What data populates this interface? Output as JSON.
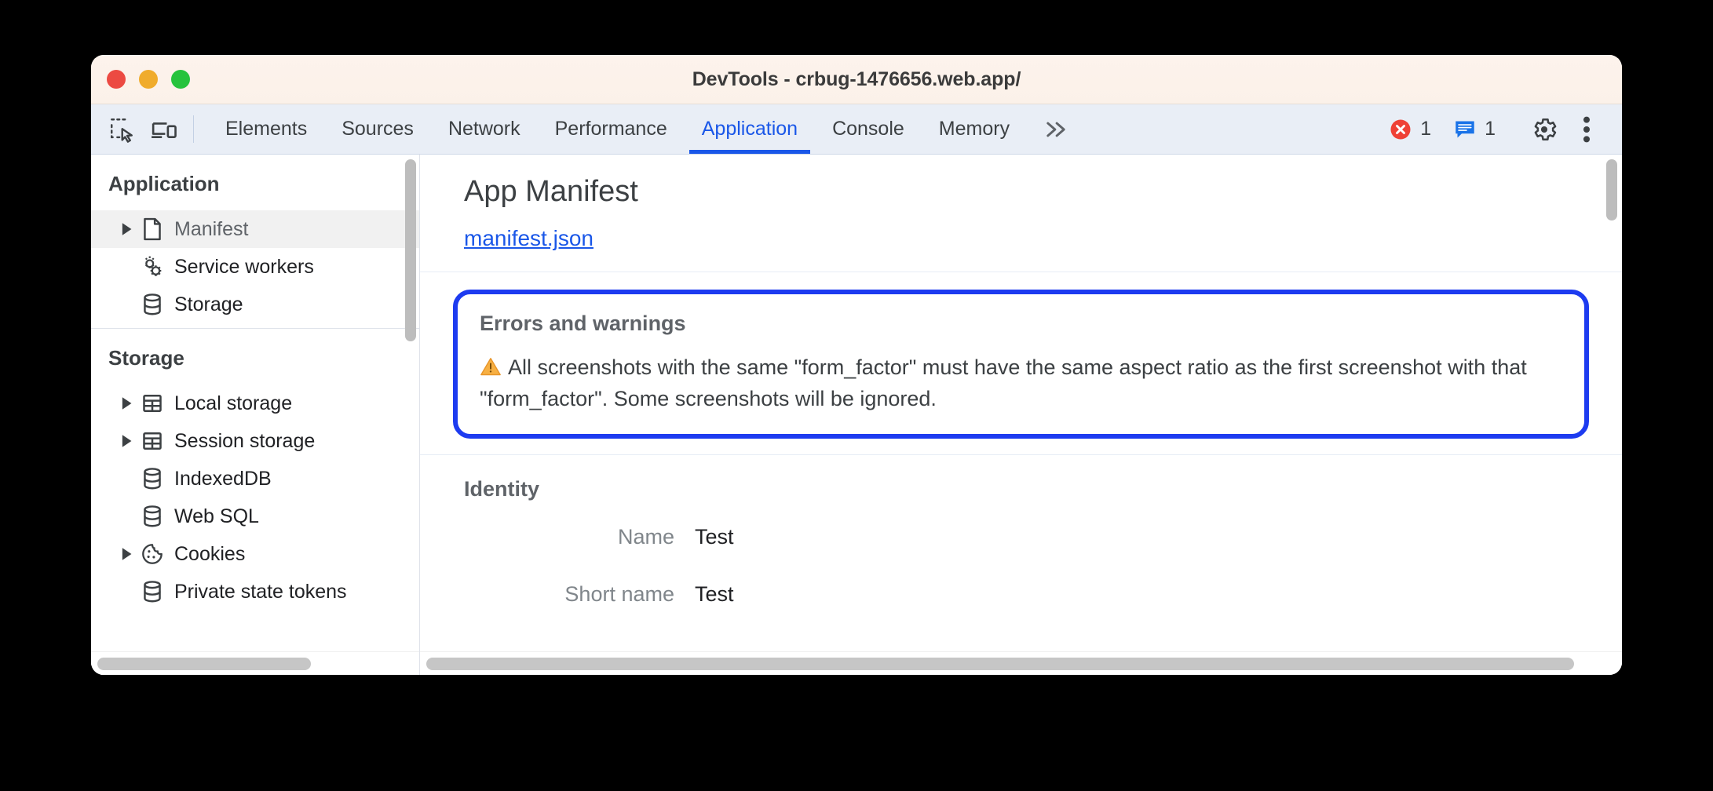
{
  "window": {
    "title": "DevTools - crbug-1476656.web.app/",
    "traffic_lights": [
      "close-red",
      "minimize-amber",
      "zoom-green"
    ],
    "colors": {
      "titlebar_bg": "#fbf1e9",
      "toolbar_bg": "#e9eef6",
      "accent_blue": "#1a57e8",
      "highlight_border": "#1d3bf0",
      "warning_orange": "#f5a623",
      "error_red": "#ef4136"
    }
  },
  "toolbar": {
    "inspect_icon": "inspect-element-icon",
    "device_icon": "device-toolbar-icon",
    "tabs": [
      {
        "label": "Elements",
        "active": false
      },
      {
        "label": "Sources",
        "active": false
      },
      {
        "label": "Network",
        "active": false
      },
      {
        "label": "Performance",
        "active": false
      },
      {
        "label": "Application",
        "active": true
      },
      {
        "label": "Console",
        "active": false
      },
      {
        "label": "Memory",
        "active": false
      }
    ],
    "more_tabs_glyph": "»",
    "error_count": "1",
    "message_count": "1",
    "settings_icon": "gear-icon",
    "more_icon": "three-dot-menu-icon"
  },
  "sidebar": {
    "sections": [
      {
        "title": "Application",
        "items": [
          {
            "label": "Manifest",
            "icon": "document-icon",
            "expandable": true,
            "selected": true
          },
          {
            "label": "Service workers",
            "icon": "gears-icon",
            "expandable": false,
            "selected": false
          },
          {
            "label": "Storage",
            "icon": "database-icon",
            "expandable": false,
            "selected": false
          }
        ]
      },
      {
        "title": "Storage",
        "items": [
          {
            "label": "Local storage",
            "icon": "table-icon",
            "expandable": true,
            "selected": false
          },
          {
            "label": "Session storage",
            "icon": "table-icon",
            "expandable": true,
            "selected": false
          },
          {
            "label": "IndexedDB",
            "icon": "database-icon",
            "expandable": false,
            "selected": false
          },
          {
            "label": "Web SQL",
            "icon": "database-icon",
            "expandable": false,
            "selected": false
          },
          {
            "label": "Cookies",
            "icon": "cookie-icon",
            "expandable": true,
            "selected": false
          },
          {
            "label": "Private state tokens",
            "icon": "database-icon",
            "expandable": false,
            "selected": false
          }
        ]
      }
    ]
  },
  "main": {
    "panel_title": "App Manifest",
    "manifest_link": "manifest.json",
    "errors_panel": {
      "title": "Errors and warnings",
      "warning_icon": "warning-triangle-icon",
      "message": "All screenshots with the same \"form_factor\" must have the same aspect ratio as the first screenshot with that \"form_factor\". Some screenshots will be ignored."
    },
    "identity": {
      "title": "Identity",
      "fields": [
        {
          "label": "Name",
          "value": "Test"
        },
        {
          "label": "Short name",
          "value": "Test"
        }
      ]
    }
  }
}
